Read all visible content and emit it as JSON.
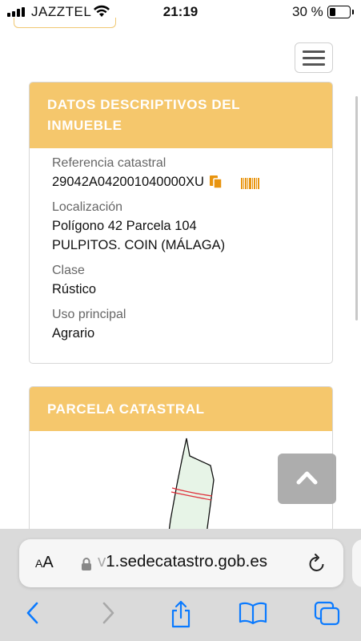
{
  "status_bar": {
    "carrier": "JAZZTEL",
    "time": "21:19",
    "battery": "30 %",
    "battery_level": 0.3
  },
  "card_descriptive": {
    "title": "DATOS DESCRIPTIVOS DEL INMUEBLE",
    "fields": [
      {
        "label": "Referencia catastral",
        "value": "29042A042001040000XU"
      },
      {
        "label": "Localización",
        "value": "Polígono 42 Parcela 104",
        "value2": "PULPITOS. COIN (MÁLAGA)"
      },
      {
        "label": "Clase",
        "value": "Rústico"
      },
      {
        "label": "Uso principal",
        "value": "Agrario"
      }
    ],
    "icons": [
      "copy-icon",
      "barcode-icon"
    ]
  },
  "card_parcel": {
    "title": "PARCELA CATASTRAL"
  },
  "browser": {
    "aa_label_small": "A",
    "aa_label_large": "A",
    "url_dim": "v",
    "url": "1.sedecatastro.gob.es"
  },
  "colors": {
    "card_header": "#f5c76c",
    "accent_icon": "#e8940f",
    "ios_blue": "#0a7aff"
  }
}
